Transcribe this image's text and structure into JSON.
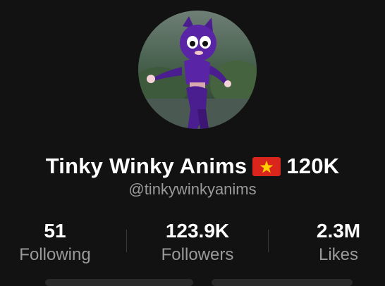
{
  "profile": {
    "display_name": "Tinky Winky Anims",
    "follower_badge": "120K",
    "handle": "@tinkywinkyanims",
    "flag_icon": "vietnam-flag-icon"
  },
  "stats": {
    "following": {
      "value": "51",
      "label": "Following"
    },
    "followers": {
      "value": "123.9K",
      "label": "Followers"
    },
    "likes": {
      "value": "2.3M",
      "label": "Likes"
    }
  },
  "colors": {
    "background": "#121212",
    "secondary_text": "#9a9a9a",
    "flag_red": "#da251d",
    "flag_star": "#ffcd00"
  }
}
